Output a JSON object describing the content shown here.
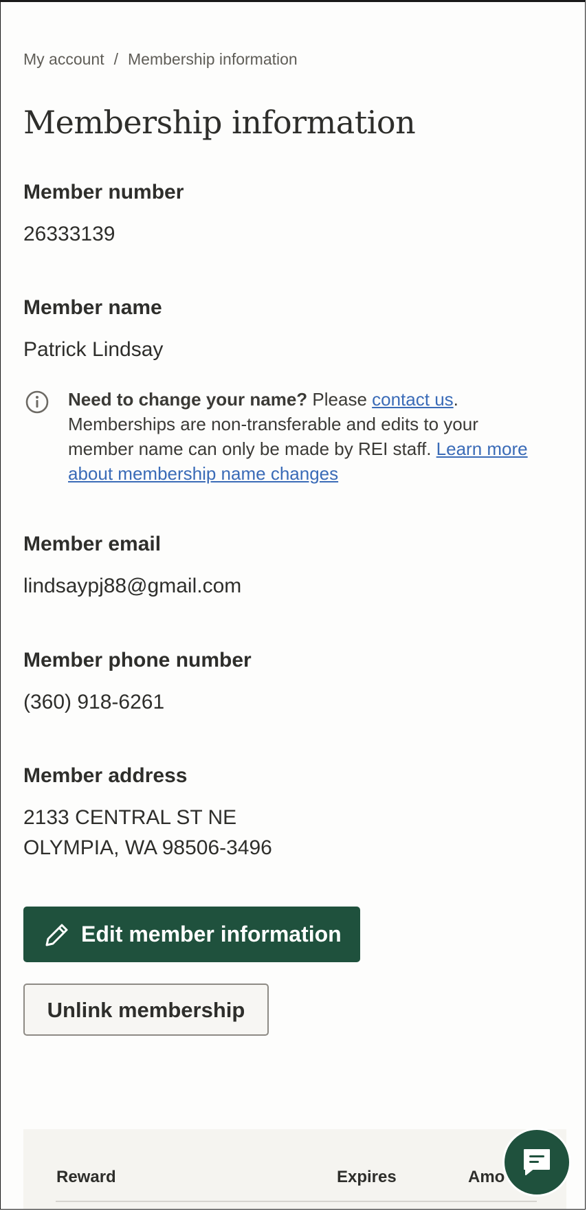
{
  "breadcrumb": {
    "items": [
      "My account",
      "Membership information"
    ],
    "separator": "/"
  },
  "page": {
    "title": "Membership information"
  },
  "fields": {
    "member_number": {
      "label": "Member number",
      "value": "26333139"
    },
    "member_name": {
      "label": "Member name",
      "value": "Patrick Lindsay"
    },
    "member_email": {
      "label": "Member email",
      "value": "lindsaypj88@gmail.com"
    },
    "member_phone": {
      "label": "Member phone number",
      "value": "(360) 918-6261"
    },
    "member_address": {
      "label": "Member address",
      "line1": "2133 CENTRAL ST NE",
      "line2": "OLYMPIA, WA 98506-3496"
    }
  },
  "notice": {
    "icon": "info-icon",
    "heading": "Need to change your name?",
    "pre_link": " Please ",
    "contact_link": "contact us",
    "body": ". Memberships are non-transferable and edits to your member name can only be made by REI staff. ",
    "learn_link": "Learn more about membership name changes"
  },
  "buttons": {
    "edit_label": "Edit member information",
    "edit_icon": "pencil-icon",
    "unlink_label": "Unlink membership"
  },
  "rewards_table": {
    "columns": [
      "Reward",
      "Expires",
      "Amo"
    ]
  },
  "chat": {
    "icon": "chat-icon"
  },
  "colors": {
    "primary": "#1f513d",
    "link": "#3a6bb7",
    "text": "#2e2e2b",
    "muted": "#5f5d57"
  }
}
